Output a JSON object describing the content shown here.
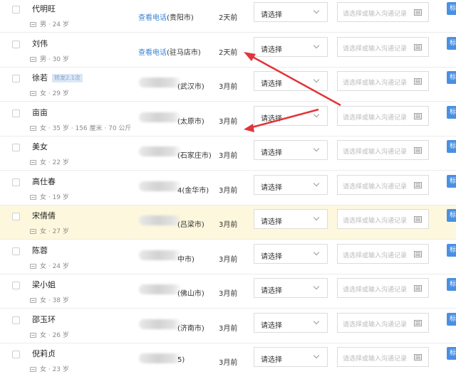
{
  "common": {
    "view_phone": "查看电话",
    "select_placeholder": "请选择",
    "record_placeholder": "请选择或输入沟通记录",
    "action_label": "标"
  },
  "rows": [
    {
      "name": "代明旺",
      "tag": "",
      "meta": "男 · 24 岁",
      "phone": "",
      "view_phone": true,
      "city": "(贵阳市)",
      "time": "2天前",
      "highlight": false
    },
    {
      "name": "刘伟",
      "tag": "",
      "meta": "男 · 30 岁",
      "phone": "",
      "view_phone": true,
      "city": "(驻马店市)",
      "time": "2天前",
      "highlight": false
    },
    {
      "name": "徐若",
      "tag": "转发2.1次",
      "meta": "女 · 29 岁",
      "phone": "1372021",
      "view_phone": false,
      "city": "(武汉市)",
      "time": "3月前",
      "highlight": false
    },
    {
      "name": "亩亩",
      "tag": "",
      "meta": "女 · 35 岁 · 156 厘米 · 70 公斤",
      "phone": "13000000",
      "view_phone": false,
      "city": "(太原市)",
      "time": "3月前",
      "highlight": false
    },
    {
      "name": "美女",
      "tag": "",
      "meta": "女 · 22 岁",
      "phone": "",
      "view_phone": false,
      "city": "(石家庄市)",
      "time": "3月前",
      "highlight": false
    },
    {
      "name": "高仕春",
      "tag": "",
      "meta": "女 · 19 岁",
      "phone": "",
      "view_phone": false,
      "city": "4(金华市)",
      "time": "3月前",
      "highlight": false
    },
    {
      "name": "宋倩倩",
      "tag": "",
      "meta": "女 · 27 岁",
      "phone": "405397",
      "view_phone": false,
      "city": "(吕梁市)",
      "time": "3月前",
      "highlight": true
    },
    {
      "name": "陈蓉",
      "tag": "",
      "meta": "女 · 24 岁",
      "phone": "",
      "view_phone": false,
      "city": "中市)",
      "time": "3月前",
      "highlight": false
    },
    {
      "name": "梁小姐",
      "tag": "",
      "meta": "女 · 38 岁",
      "phone": "",
      "view_phone": false,
      "city": "(佛山市)",
      "time": "3月前",
      "highlight": false
    },
    {
      "name": "邵玉环",
      "tag": "",
      "meta": "女 · 26 岁",
      "phone": "",
      "view_phone": false,
      "city": "(济南市)",
      "time": "3月前",
      "highlight": false
    },
    {
      "name": "倪莉贞",
      "tag": "",
      "meta": "女 · 23 岁",
      "phone": "",
      "view_phone": false,
      "city": "5)",
      "time": "3月前",
      "highlight": false
    }
  ],
  "annotation": {
    "arrow_color": "#e0353a"
  }
}
